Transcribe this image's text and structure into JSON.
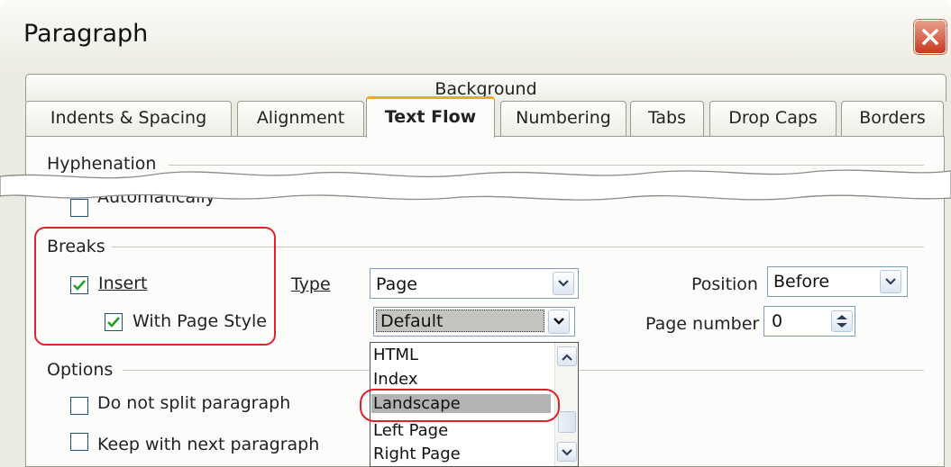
{
  "window": {
    "title": "Paragraph"
  },
  "tabs": {
    "upper": [
      {
        "label": "Background"
      }
    ],
    "lower": [
      {
        "label": "Indents & Spacing"
      },
      {
        "label": "Alignment"
      },
      {
        "label": "Text Flow",
        "active": true
      },
      {
        "label": "Numbering"
      },
      {
        "label": "Tabs"
      },
      {
        "label": "Drop Caps"
      },
      {
        "label": "Borders"
      }
    ]
  },
  "hyphenation": {
    "legend": "Hyphenation",
    "automatically": {
      "label": "Automatically",
      "checked": false
    }
  },
  "breaks": {
    "legend": "Breaks",
    "insert": {
      "label": "Insert",
      "checked": true
    },
    "with_page_style": {
      "label": "With Page Style",
      "checked": true
    },
    "type": {
      "label": "Type",
      "value": "Page"
    },
    "position": {
      "label": "Position",
      "value": "Before"
    },
    "page_style": {
      "value": "Default"
    },
    "page_number": {
      "label": "Page number",
      "value": "0"
    }
  },
  "page_style_list": {
    "items": [
      "HTML",
      "Index",
      "Landscape",
      "Left Page",
      "Right Page"
    ],
    "selected": "Landscape"
  },
  "options": {
    "legend": "Options",
    "do_not_split": {
      "label": "Do not split paragraph",
      "checked": false
    },
    "keep_with_next": {
      "label": "Keep with next paragraph",
      "checked": false
    }
  },
  "colors": {
    "accent_tab": "#f5a623",
    "callout": "#e0202a",
    "close_button": "#c9391f"
  },
  "icons": [
    "close-icon",
    "checkmark-icon",
    "chevron-down-icon",
    "chevron-up-icon",
    "spinner-icon"
  ]
}
